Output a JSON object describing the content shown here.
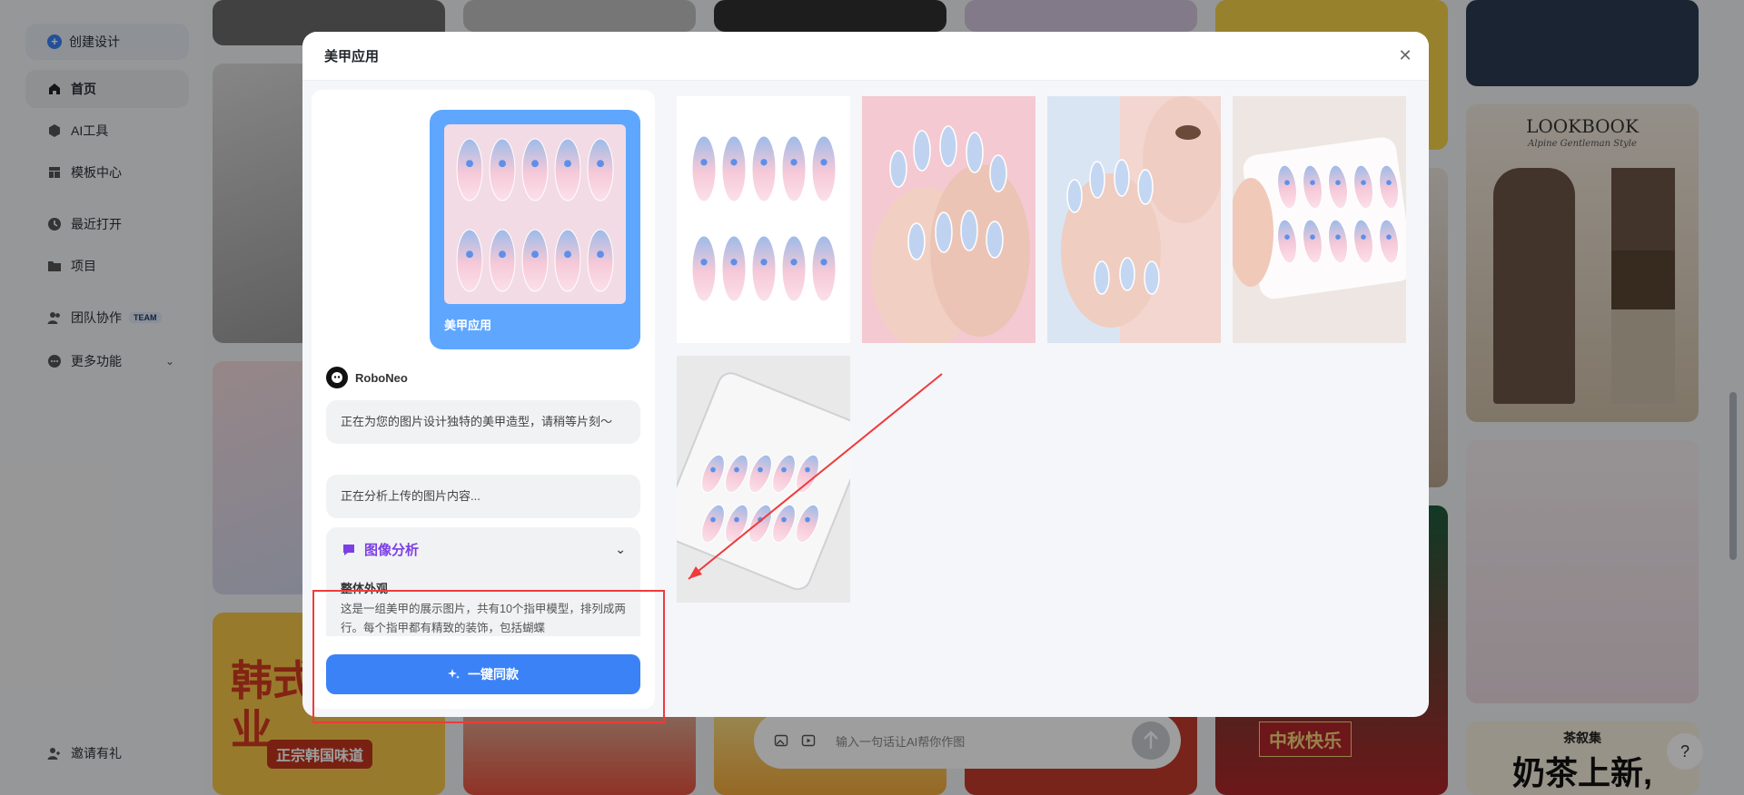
{
  "sidebar": {
    "create_label": "创建设计",
    "items": [
      {
        "label": "首页",
        "icon": "home-icon"
      },
      {
        "label": "AI工具",
        "icon": "cube-icon"
      },
      {
        "label": "模板中心",
        "icon": "template-icon"
      },
      {
        "label": "最近打开",
        "icon": "clock-icon"
      },
      {
        "label": "项目",
        "icon": "folder-icon"
      },
      {
        "label": "团队协作",
        "icon": "team-icon",
        "badge": "TEAM"
      },
      {
        "label": "更多功能",
        "icon": "more-icon"
      }
    ],
    "invite_label": "邀请有礼"
  },
  "modal": {
    "title": "美甲应用",
    "card_label": "美甲应用",
    "bot_name": "RoboNeo",
    "messages": [
      "正在为您的图片设计独特的美甲造型，请稍等片刻～",
      "正在分析上传的图片内容..."
    ],
    "analysis_title": "图像分析",
    "analysis_subtitle": "整体外观",
    "analysis_text": "这是一组美甲的展示图片，共有10个指甲模型，排列成两行。每个指甲都有精致的装饰，包括蝴蝶",
    "cta_label": "一键同款"
  },
  "bottom": {
    "input_placeholder": "输入一句话让AI帮你作图",
    "help_label": "?"
  },
  "background": {
    "lookbook_title": "LOOKBOOK",
    "lookbook_subtitle": "Alpine Gentleman Style",
    "poster_text": "韩式新店开业",
    "poster_sub": "正宗韩国味道",
    "tea_text": "奶茶上新,",
    "tea_brand": "茶叙集",
    "moon_text": "中秋快乐"
  },
  "colors": {
    "accent": "#3b82f6",
    "card_blue": "#5fa6ff",
    "analysis_purple": "#7b3fe4",
    "annotation_red": "#ee3b3b"
  }
}
